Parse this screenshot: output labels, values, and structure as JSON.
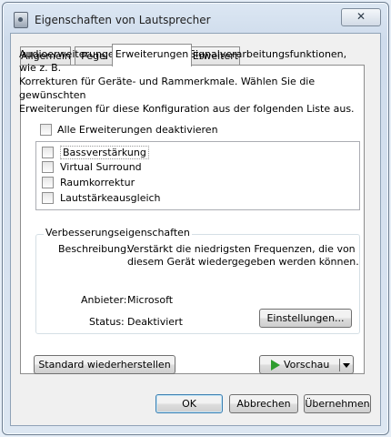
{
  "window": {
    "title": "Eigenschaften von Lautsprecher",
    "close_glyph": "✕"
  },
  "tabs": [
    {
      "label": "Allgemein"
    },
    {
      "label": "Pegel"
    },
    {
      "label": "Erweiterungen",
      "active": true
    },
    {
      "label": "Erweitert"
    }
  ],
  "description": "Audioerweiterungen ermöglichen Signalverarbeitungsfunktionen, wie z. B. Korrekturen für Geräte- und Rammerkmale. Wählen Sie die gewünschten Erweiterungen für diese Konfiguration aus der folgenden Liste aus.",
  "description_lines": [
    "Audioerweiterungen ermöglichen Signalverarbeitungsfunktionen, wie z. B.",
    "Korrekturen für Geräte- und Rammerkmale. Wählen Sie die gewünschten",
    "Erweiterungen für diese Konfiguration aus der folgenden Liste aus."
  ],
  "disable_all": {
    "label": "Alle Erweiterungen deaktivieren",
    "checked": false
  },
  "enhancements": [
    {
      "label": "Bassverstärkung",
      "checked": false,
      "selected": true
    },
    {
      "label": "Virtual Surround",
      "checked": false
    },
    {
      "label": "Raumkorrektur",
      "checked": false
    },
    {
      "label": "Lautstärkeausgleich",
      "checked": false
    }
  ],
  "properties": {
    "group_label": "Verbesserungseigenschaften",
    "description_label": "Beschreibung:",
    "description_line1": "Verstärkt die niedrigsten Frequenzen, die von",
    "description_line2": "diesem Gerät wiedergegeben werden können.",
    "provider_label": "Anbieter:",
    "provider_value": "Microsoft",
    "status_label": "Status:",
    "status_value": "Deaktiviert",
    "settings_button": "Einstellungen..."
  },
  "buttons": {
    "restore_defaults": "Standard wiederherstellen",
    "preview": "Vorschau",
    "ok": "OK",
    "cancel": "Abbrechen",
    "apply": "Übernehmen"
  },
  "colors": {
    "accent_play": "#2d9c2d",
    "window_frame": "#6d7e91"
  }
}
